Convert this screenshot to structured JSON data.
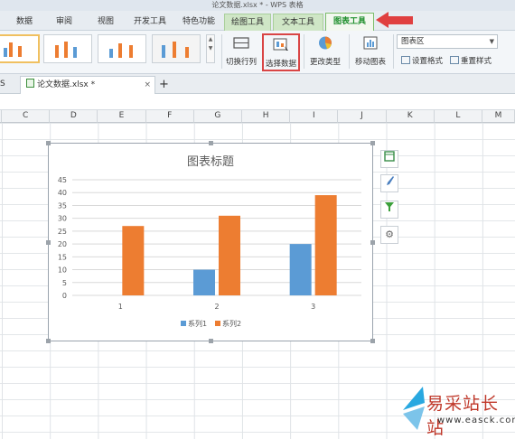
{
  "window": {
    "title": "论文数据.xlsx * - WPS 表格"
  },
  "tabs": [
    {
      "label": "数据"
    },
    {
      "label": "审阅"
    },
    {
      "label": "视图"
    },
    {
      "label": "开发工具"
    },
    {
      "label": "特色功能"
    },
    {
      "label": "绘图工具"
    },
    {
      "label": "文本工具"
    },
    {
      "label": "图表工具"
    }
  ],
  "ribbon": {
    "switch_rowcol": "切换行列",
    "select_data": "选择数据",
    "change_type": "更改类型",
    "move_chart": "移动图表",
    "element_select": "图表区",
    "format_setting": "设置格式",
    "reset_style": "重置样式",
    "gallery_up": "▲",
    "gallery_down": "▼"
  },
  "docbar": {
    "left_tab": "S",
    "file_name": "论文数据.xlsx *",
    "close": "×",
    "new_tab": "+"
  },
  "columns": [
    "C",
    "D",
    "E",
    "F",
    "G",
    "H",
    "I",
    "J",
    "K",
    "L",
    "M"
  ],
  "chart_data": {
    "type": "bar",
    "title": "图表标题",
    "categories": [
      "1",
      "2",
      "3"
    ],
    "series": [
      {
        "name": "系列1",
        "color": "#5b9bd5",
        "values": [
          0,
          10,
          20
        ]
      },
      {
        "name": "系列2",
        "color": "#ed7d31",
        "values": [
          27,
          31,
          39
        ]
      }
    ],
    "ylim": [
      0,
      45
    ],
    "yticks": [
      0,
      5,
      10,
      15,
      20,
      25,
      30,
      35,
      40,
      45
    ],
    "grid": true,
    "legend": "bottom"
  },
  "side_icons": [
    "chart-elements-icon",
    "brush-icon",
    "filter-icon",
    "gear-icon"
  ],
  "watermark": {
    "line1": "易采站长站",
    "line2": "www.easck.com"
  },
  "colors": {
    "accent_green": "#1f8f2d",
    "highlight_red": "#d94545"
  }
}
